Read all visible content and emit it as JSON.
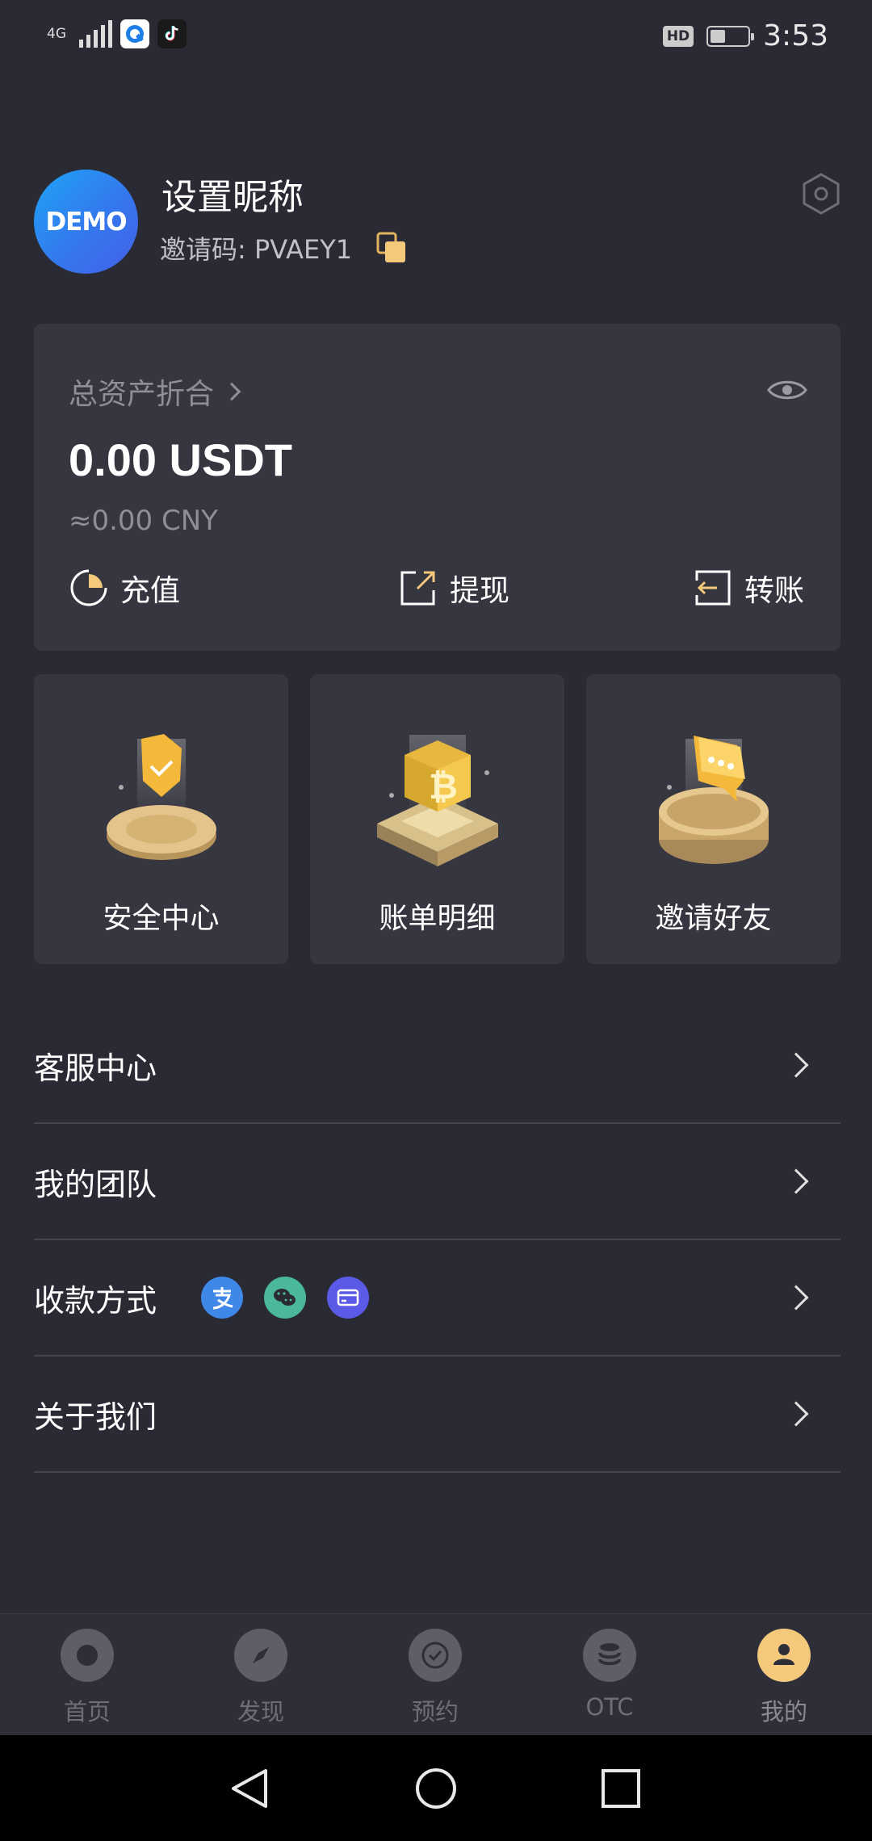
{
  "status_bar": {
    "network": "4G",
    "hd_badge": "HD",
    "time": "3:53",
    "battery_level": 0.4
  },
  "profile": {
    "avatar_text": "DEMO",
    "nickname": "设置昵称",
    "invite_label": "邀请码: PVAEY1"
  },
  "assets": {
    "label": "总资产折合",
    "total": "0.00 USDT",
    "cny": "≈0.00 CNY",
    "actions": {
      "deposit": "充值",
      "withdraw": "提现",
      "transfer": "转账"
    }
  },
  "tiles": {
    "security": "安全中心",
    "bills": "账单明细",
    "invite": "邀请好友"
  },
  "menu": {
    "service": "客服中心",
    "team": "我的团队",
    "payment": "收款方式",
    "about": "关于我们"
  },
  "bottom_nav": {
    "home": "首页",
    "discover": "发现",
    "booking": "预约",
    "otc": "OTC",
    "mine": "我的"
  },
  "colors": {
    "background": "#2a2a34",
    "card": "#363640",
    "accent_gold": "#f4c97c",
    "alipay": "#3f88e8",
    "wechat": "#4cb89b",
    "bank_card": "#5a5ae6"
  }
}
